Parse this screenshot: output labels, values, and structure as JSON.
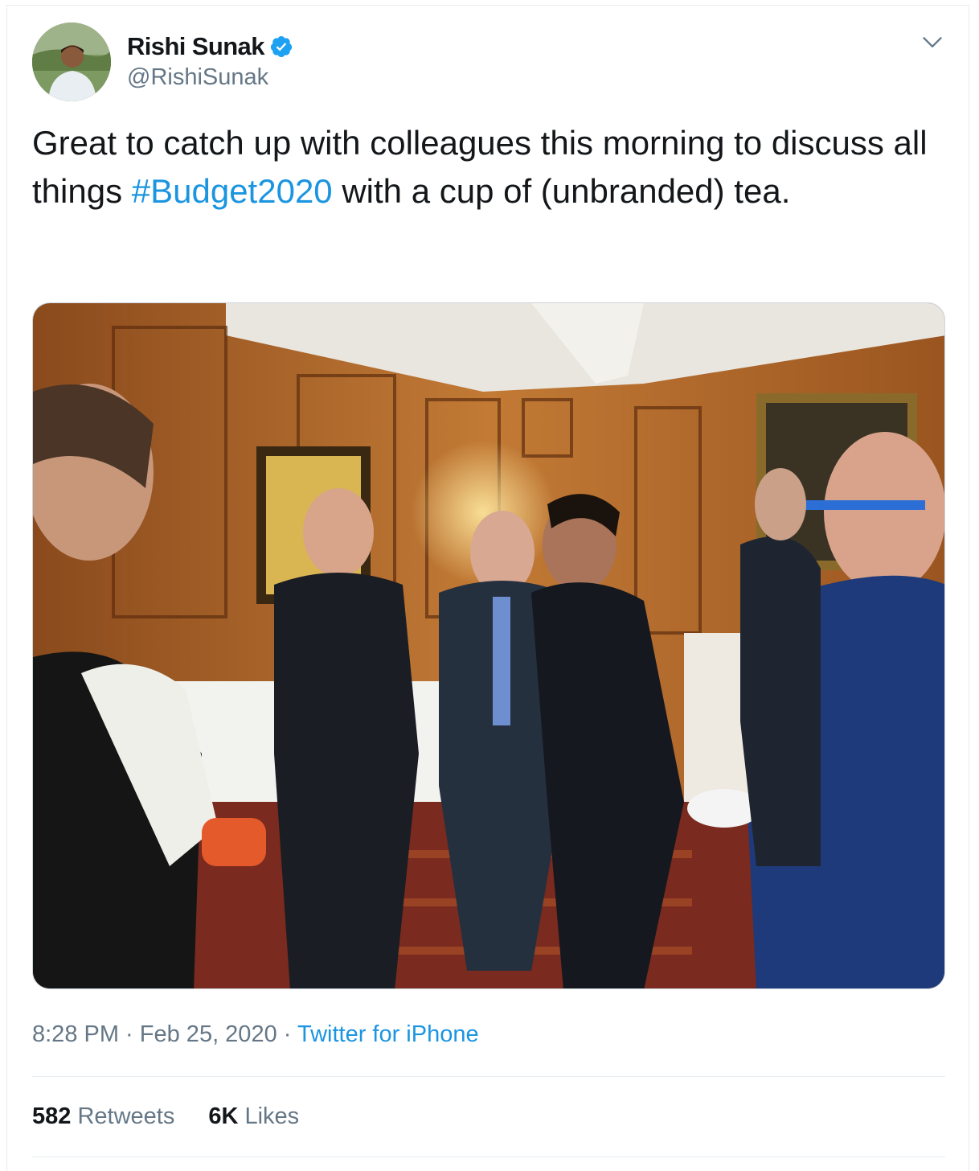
{
  "author": {
    "display_name": "Rishi Sunak",
    "handle": "@RishiSunak",
    "verified": true
  },
  "icons": {
    "verified": "verified-badge-icon",
    "menu": "chevron-down-icon"
  },
  "tweet": {
    "text_before": "Great to catch up with colleagues this morning to discuss all things ",
    "hashtag": "#Budget2020",
    "text_after": " with a cup of (unbranded) tea."
  },
  "timestamp": {
    "time": "8:28 PM",
    "separator": " · ",
    "date": "Feb 25, 2020",
    "source": "Twitter for iPhone"
  },
  "stats": {
    "retweets_count": "582",
    "retweets_label": "Retweets",
    "likes_count": "6K",
    "likes_label": "Likes"
  },
  "colors": {
    "link": "#1b95e0",
    "muted": "#657786",
    "text": "#14171a",
    "divider": "#e6ecf0"
  }
}
